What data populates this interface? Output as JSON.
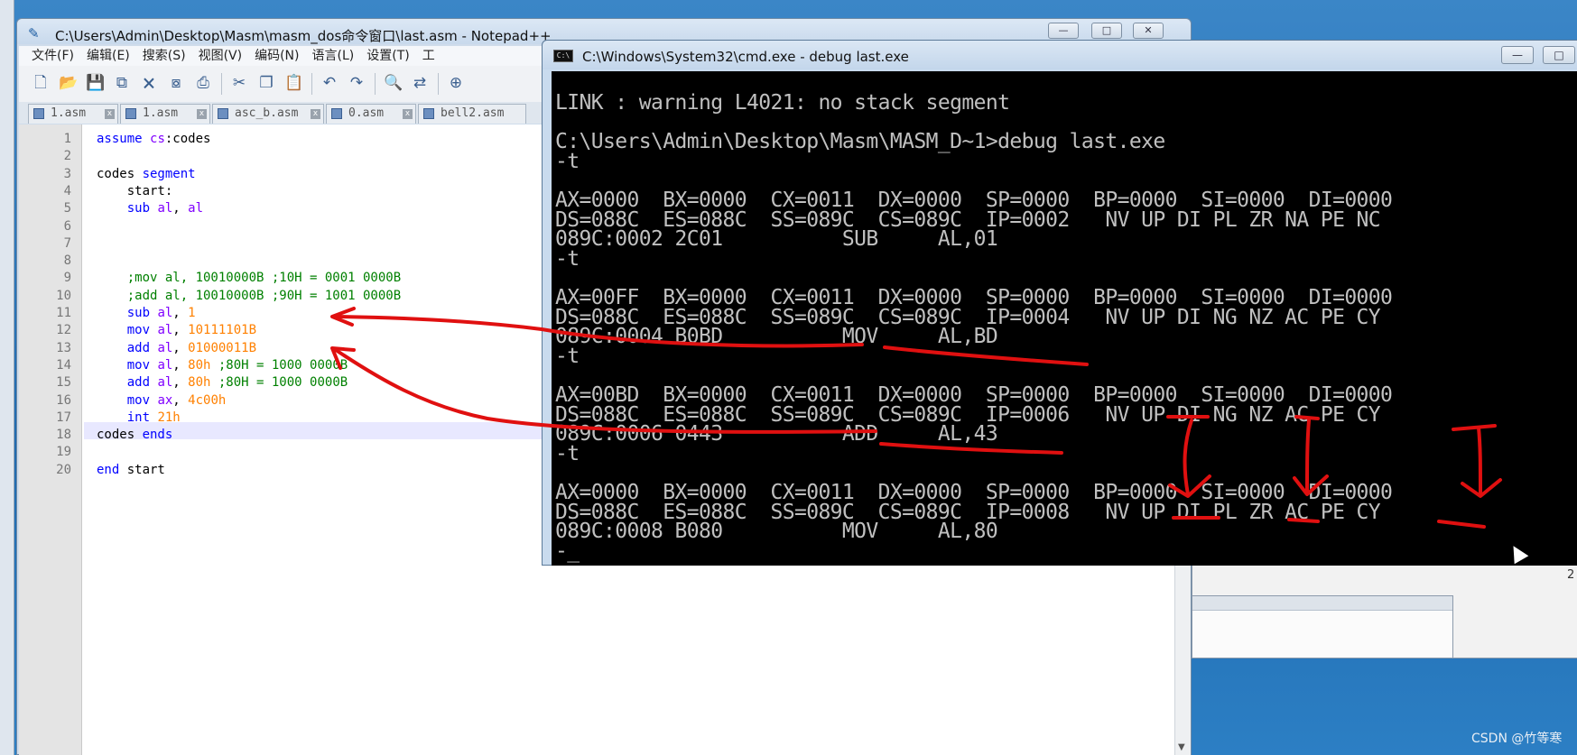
{
  "notepad": {
    "title": "C:\\Users\\Admin\\Desktop\\Masm\\masm_dos命令窗口\\last.asm - Notepad++",
    "window_buttons": [
      "—",
      "□",
      "✕"
    ],
    "menu": [
      "文件(F)",
      "编辑(E)",
      "搜索(S)",
      "视图(V)",
      "编码(N)",
      "语言(L)",
      "设置(T)",
      "工"
    ],
    "tabs": [
      "1.asm",
      "1.asm",
      "asc_b.asm",
      "0.asm",
      "bell2.asm"
    ],
    "code_lines": [
      {
        "n": "1",
        "parts": [
          [
            "kw",
            "assume "
          ],
          [
            "reg",
            "cs"
          ],
          [
            "",
            ":codes"
          ]
        ]
      },
      {
        "n": "2",
        "parts": []
      },
      {
        "n": "3",
        "parts": [
          [
            "",
            "codes "
          ],
          [
            "kw",
            "segment"
          ]
        ]
      },
      {
        "n": "4",
        "parts": [
          [
            "",
            "    start:"
          ]
        ]
      },
      {
        "n": "5",
        "parts": [
          [
            "kw",
            "    sub "
          ],
          [
            "reg",
            "al"
          ],
          [
            "",
            ", "
          ],
          [
            "reg",
            "al"
          ]
        ]
      },
      {
        "n": "6",
        "parts": []
      },
      {
        "n": "7",
        "parts": []
      },
      {
        "n": "8",
        "parts": []
      },
      {
        "n": "9",
        "parts": [
          [
            "cm",
            "    ;mov al, 10010000B ;10H = 0001 0000B"
          ]
        ]
      },
      {
        "n": "10",
        "parts": [
          [
            "cm",
            "    ;add al, 10010000B ;90H = 1001 0000B"
          ]
        ]
      },
      {
        "n": "11",
        "parts": [
          [
            "kw",
            "    sub "
          ],
          [
            "reg",
            "al"
          ],
          [
            "",
            ", "
          ],
          [
            "num",
            "1"
          ]
        ]
      },
      {
        "n": "12",
        "parts": [
          [
            "kw",
            "    mov "
          ],
          [
            "reg",
            "al"
          ],
          [
            "",
            ", "
          ],
          [
            "num",
            "10111101B"
          ]
        ]
      },
      {
        "n": "13",
        "parts": [
          [
            "kw",
            "    add "
          ],
          [
            "reg",
            "al"
          ],
          [
            "",
            ", "
          ],
          [
            "num",
            "01000011B"
          ]
        ]
      },
      {
        "n": "14",
        "parts": [
          [
            "kw",
            "    mov "
          ],
          [
            "reg",
            "al"
          ],
          [
            "",
            ", "
          ],
          [
            "num",
            "80h"
          ],
          [
            "cm",
            " ;80H = 1000 0000B"
          ]
        ]
      },
      {
        "n": "15",
        "parts": [
          [
            "kw",
            "    add "
          ],
          [
            "reg",
            "al"
          ],
          [
            "",
            ", "
          ],
          [
            "num",
            "80h"
          ],
          [
            "cm",
            " ;80H = 1000 0000B"
          ]
        ]
      },
      {
        "n": "16",
        "parts": [
          [
            "kw",
            "    mov "
          ],
          [
            "reg",
            "ax"
          ],
          [
            "",
            ", "
          ],
          [
            "num",
            "4c00h"
          ]
        ]
      },
      {
        "n": "17",
        "parts": [
          [
            "kw",
            "    int "
          ],
          [
            "num",
            "21h"
          ]
        ]
      },
      {
        "n": "18",
        "parts": [
          [
            "",
            "codes "
          ],
          [
            "kw",
            "ends"
          ]
        ]
      },
      {
        "n": "19",
        "parts": []
      },
      {
        "n": "20",
        "parts": [
          [
            "kw",
            "end "
          ],
          [
            "",
            "start"
          ]
        ]
      }
    ]
  },
  "cmd": {
    "title": "C:\\Windows\\System32\\cmd.exe - debug  last.exe",
    "icon_text": "C:\\",
    "window_buttons": [
      "—",
      "□"
    ],
    "lines": [
      "LINK : warning L4021: no stack segment",
      "",
      "C:\\Users\\Admin\\Desktop\\Masm\\MASM_D~1>debug last.exe",
      "-t",
      "",
      "AX=0000  BX=0000  CX=0011  DX=0000  SP=0000  BP=0000  SI=0000  DI=0000",
      "DS=088C  ES=088C  SS=089C  CS=089C  IP=0002   NV UP DI PL ZR NA PE NC",
      "089C:0002 2C01          SUB     AL,01",
      "-t",
      "",
      "AX=00FF  BX=0000  CX=0011  DX=0000  SP=0000  BP=0000  SI=0000  DI=0000",
      "DS=088C  ES=088C  SS=089C  CS=089C  IP=0004   NV UP DI NG NZ AC PE CY",
      "089C:0004 B0BD          MOV     AL,BD",
      "-t",
      "",
      "AX=00BD  BX=0000  CX=0011  DX=0000  SP=0000  BP=0000  SI=0000  DI=0000",
      "DS=088C  ES=088C  SS=089C  CS=089C  IP=0006   NV UP DI NG NZ AC PE CY",
      "089C:0006 0443          ADD     AL,43",
      "-t",
      "",
      "AX=0000  BX=0000  CX=0011  DX=0000  SP=0000  BP=0000  SI=0000  DI=0000",
      "DS=088C  ES=088C  SS=089C  CS=089C  IP=0008   NV UP DI PL ZR AC PE CY",
      "089C:0008 B080          MOV     AL,80",
      "-_"
    ]
  },
  "background": {
    "side_number": "2"
  },
  "watermark": "CSDN @竹等寒",
  "colors": {
    "annotation_red": "#e01010",
    "console_bg": "#000000",
    "console_fg": "#c0c0c0"
  }
}
